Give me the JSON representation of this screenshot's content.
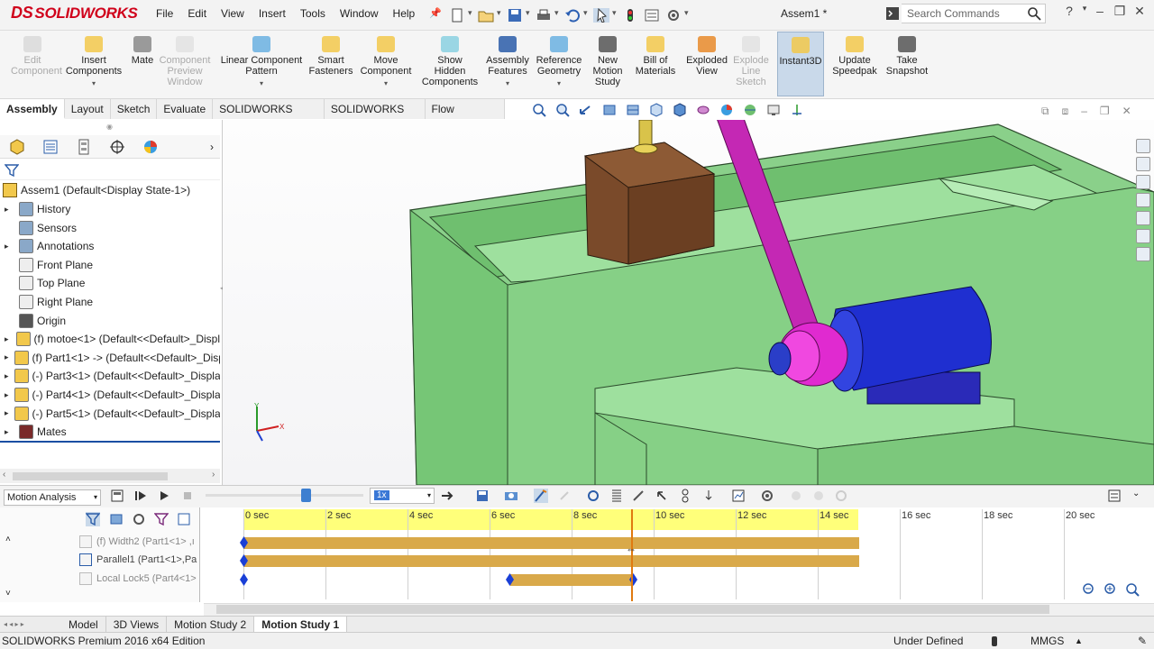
{
  "app": {
    "name": "SOLIDWORKS",
    "doc_title": "Assem1 *",
    "menus": [
      "File",
      "Edit",
      "View",
      "Insert",
      "Tools",
      "Window",
      "Help"
    ],
    "search_placeholder": "Search Commands"
  },
  "ribbon": {
    "buttons": [
      {
        "label": "Edit\nComponent",
        "disabled": true
      },
      {
        "label": "Insert\nComponents"
      },
      {
        "label": "Mate"
      },
      {
        "label": "Component\nPreview\nWindow",
        "disabled": true
      },
      {
        "label": "Linear Component\nPattern"
      },
      {
        "label": "Smart\nFasteners"
      },
      {
        "label": "Move\nComponent"
      },
      {
        "label": "Show\nHidden\nComponents"
      },
      {
        "label": "Assembly\nFeatures"
      },
      {
        "label": "Reference\nGeometry"
      },
      {
        "label": "New\nMotion\nStudy"
      },
      {
        "label": "Bill of\nMaterials"
      },
      {
        "label": "Exploded\nView"
      },
      {
        "label": "Explode\nLine\nSketch",
        "disabled": true
      },
      {
        "label": "Instant3D",
        "active": true
      },
      {
        "label": "Update\nSpeedpak"
      },
      {
        "label": "Take\nSnapshot"
      }
    ]
  },
  "tabs": [
    "Assembly",
    "Layout",
    "Sketch",
    "Evaluate",
    "SOLIDWORKS Add-Ins",
    "SOLIDWORKS MBD",
    "Flow Simulation"
  ],
  "active_tab": "Assembly",
  "tree": {
    "root": "Assem1  (Default<Display State-1>)",
    "items": [
      {
        "label": "History",
        "expandable": true
      },
      {
        "label": "Sensors"
      },
      {
        "label": "Annotations",
        "expandable": true
      },
      {
        "label": "Front Plane"
      },
      {
        "label": "Top Plane"
      },
      {
        "label": "Right Plane"
      },
      {
        "label": "Origin"
      },
      {
        "label": "(f) motoe<1> (Default<<Default>_Displ",
        "expandable": true
      },
      {
        "label": "(f) Part1<1> -> (Default<<Default>_Disp",
        "expandable": true
      },
      {
        "label": "(-) Part3<1> (Default<<Default>_Display",
        "expandable": true
      },
      {
        "label": "(-) Part4<1> (Default<<Default>_Display",
        "expandable": true
      },
      {
        "label": "(-) Part5<1> (Default<<Default>_Display",
        "expandable": true
      },
      {
        "label": "Mates",
        "expandable": true
      }
    ]
  },
  "motion": {
    "study_type": "Motion Analysis",
    "speed": "1x",
    "playback_position_sec": 9.45,
    "ruler_labels": [
      "0 sec",
      "2 sec",
      "4 sec",
      "6 sec",
      "8 sec",
      "10 sec",
      "12 sec",
      "14 sec",
      "16 sec",
      "18 sec",
      "20 sec"
    ],
    "rows": [
      {
        "label": "(f) Width2 (Part1<1> ,ı",
        "dim": true,
        "bar_start": 0,
        "bar_end": 15,
        "keys": [
          0
        ]
      },
      {
        "label": "Parallel1 (Part1<1>,Pa",
        "dim": false,
        "bar_start": 0,
        "bar_end": 15,
        "keys": [
          0
        ]
      },
      {
        "label": "Local Lock5 (Part4<1>",
        "dim": true,
        "bar_start": 6.5,
        "bar_end": 9.5,
        "keys": [
          0,
          6.5,
          9.5
        ]
      }
    ]
  },
  "bottom_tabs": [
    "Model",
    "3D Views",
    "Motion Study 2",
    "Motion Study 1"
  ],
  "active_bottom_tab": "Motion Study 1",
  "status": {
    "edition": "SOLIDWORKS Premium 2016 x64 Edition",
    "state": "Under Defined",
    "units": "MMGS"
  },
  "colors": {
    "accent": "#d0021b",
    "timeline_ruler": "#ffff7a",
    "bar": "#d9a94a",
    "playhead": "#e07a10",
    "keyframe": "#1a3fd6"
  }
}
